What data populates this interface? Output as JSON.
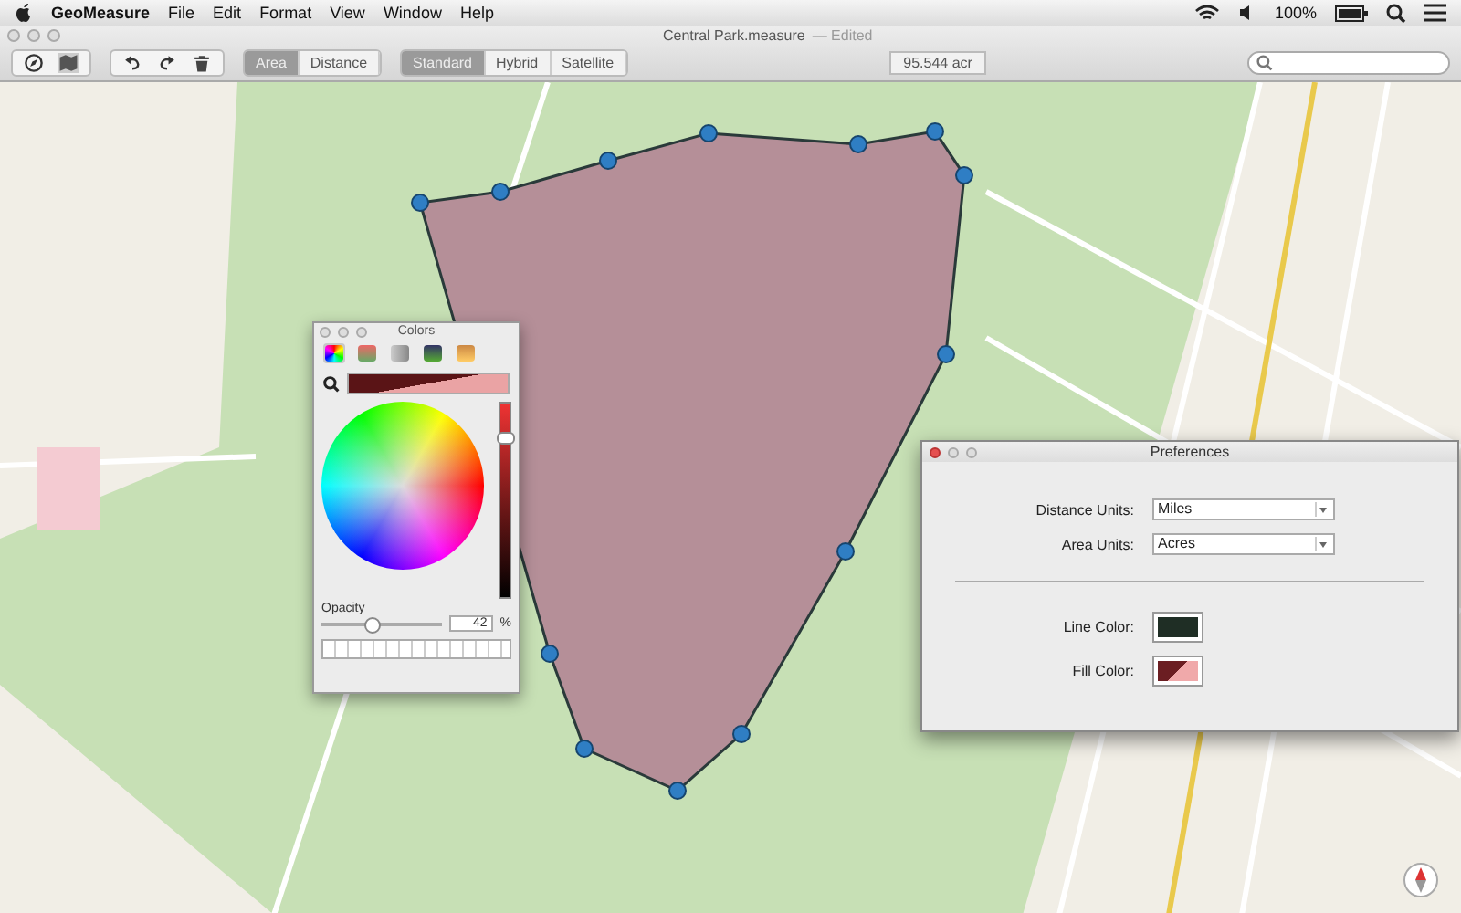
{
  "menu_bar": {
    "app": "GeoMeasure",
    "items": [
      "File",
      "Edit",
      "Format",
      "View",
      "Window",
      "Help"
    ],
    "battery": "100%"
  },
  "window": {
    "title": "Central Park.measure",
    "subtitle": "— Edited"
  },
  "toolbar": {
    "modes": [
      {
        "label": "Area",
        "selected": true
      },
      {
        "label": "Distance",
        "selected": false
      }
    ],
    "map_types": [
      {
        "label": "Standard",
        "selected": true
      },
      {
        "label": "Hybrid",
        "selected": false
      },
      {
        "label": "Satellite",
        "selected": false
      }
    ],
    "area_readout": "95.544 acr"
  },
  "colors_panel": {
    "title": "Colors",
    "tabs": [
      {
        "selected": true
      },
      {
        "selected": false
      },
      {
        "selected": false
      },
      {
        "selected": false
      },
      {
        "selected": false
      }
    ],
    "brightness": {
      "level": 0.82
    },
    "opacity_label": "Opacity",
    "opacity": {
      "level": 0.42
    },
    "opacity_value": "42",
    "opacity_unit": "%"
  },
  "preferences": {
    "title": "Preferences",
    "fields": [
      {
        "label": "Distance Units:",
        "value": "Miles"
      },
      {
        "label": "Area Units:",
        "value": "Acres"
      }
    ],
    "colors": [
      {
        "label": "Line Color:",
        "color": "#1f2e25"
      },
      {
        "label": "Fill Color:",
        "color": "#6b1e22"
      }
    ]
  }
}
